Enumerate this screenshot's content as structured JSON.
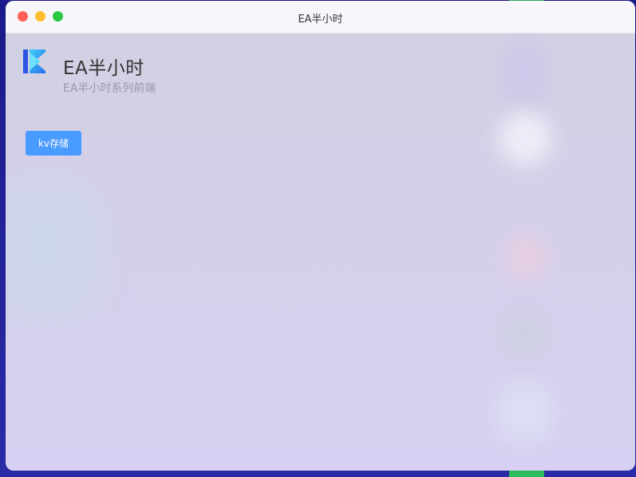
{
  "window": {
    "title": "EA半小时"
  },
  "app": {
    "logo_icon": "k-logo-icon",
    "title": "EA半小时",
    "subtitle": "EA半小时系列前端"
  },
  "actions": {
    "kv_button_label": "kv存储"
  },
  "colors": {
    "accent": "#4a9bff",
    "close": "#ff5f57",
    "minimize": "#febc2e",
    "maximize": "#28c840"
  }
}
